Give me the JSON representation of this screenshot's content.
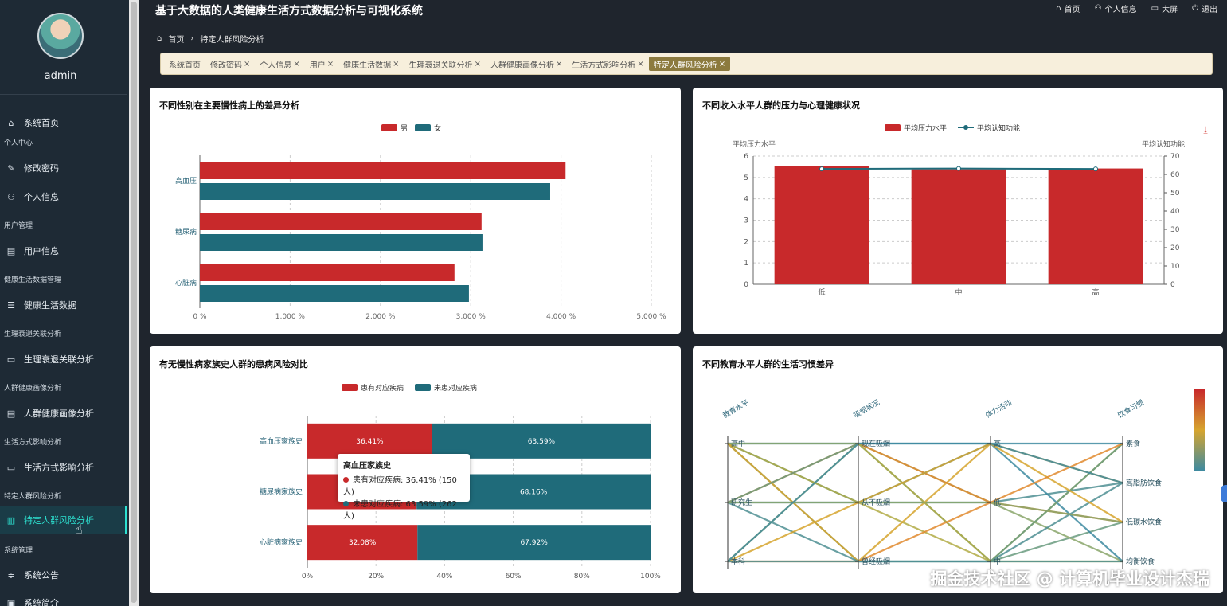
{
  "app": {
    "title": "基于大数据的人类健康生活方式数据分析与可视化系统"
  },
  "top_nav": [
    {
      "label": "首页",
      "icon": "home-icon"
    },
    {
      "label": "个人信息",
      "icon": "user-icon"
    },
    {
      "label": "大屏",
      "icon": "monitor-icon"
    },
    {
      "label": "退出",
      "icon": "power-icon"
    }
  ],
  "user": {
    "name": "admin"
  },
  "sidebar": {
    "groups": [
      {
        "label": "个人中心"
      },
      {
        "label": "用户管理"
      },
      {
        "label": "健康生活数据管理"
      },
      {
        "label": "生理衰退关联分析"
      },
      {
        "label": "人群健康画像分析"
      },
      {
        "label": "生活方式影响分析"
      },
      {
        "label": "特定人群风险分析"
      },
      {
        "label": "系统管理"
      }
    ],
    "items": [
      {
        "label": "系统首页",
        "icon": "home-icon"
      },
      {
        "label": "修改密码",
        "icon": "edit-icon"
      },
      {
        "label": "个人信息",
        "icon": "user-icon"
      },
      {
        "label": "用户信息",
        "icon": "clipboard-icon"
      },
      {
        "label": "健康生活数据",
        "icon": "list-icon"
      },
      {
        "label": "生理衰退关联分析",
        "icon": "monitor-icon"
      },
      {
        "label": "人群健康画像分析",
        "icon": "clipboard-icon"
      },
      {
        "label": "生活方式影响分析",
        "icon": "monitor-icon"
      },
      {
        "label": "特定人群风险分析",
        "icon": "chart-icon"
      },
      {
        "label": "系统公告",
        "icon": "sliders-icon"
      },
      {
        "label": "系统简介",
        "icon": "info-icon"
      }
    ]
  },
  "breadcrumb": {
    "home": "首页",
    "current": "特定人群风险分析"
  },
  "tags": [
    {
      "label": "系统首页",
      "closable": false
    },
    {
      "label": "修改密码",
      "closable": true
    },
    {
      "label": "个人信息",
      "closable": true
    },
    {
      "label": "用户",
      "closable": true
    },
    {
      "label": "健康生活数据",
      "closable": true
    },
    {
      "label": "生理衰退关联分析",
      "closable": true
    },
    {
      "label": "人群健康画像分析",
      "closable": true
    },
    {
      "label": "生活方式影响分析",
      "closable": true
    },
    {
      "label": "特定人群风险分析",
      "closable": true,
      "active": true
    }
  ],
  "colors": {
    "red": "#c8292b",
    "teal": "#1f6b7a"
  },
  "chart_data": [
    {
      "type": "bar",
      "orientation": "horizontal",
      "title": "不同性别在主要慢性病上的差异分析",
      "categories": [
        "高血压",
        "糖尿病",
        "心脏病"
      ],
      "series": [
        {
          "name": "男",
          "values": [
            4050,
            3120,
            2820
          ]
        },
        {
          "name": "女",
          "values": [
            3880,
            3130,
            2980
          ]
        }
      ],
      "x_ticks": [
        "0 %",
        "1,000 %",
        "2,000 %",
        "3,000 %",
        "4,000 %",
        "5,000 %"
      ],
      "xlim": [
        0,
        5000
      ],
      "legend": "top-center"
    },
    {
      "type": "bar",
      "title": "不同收入水平人群的压力与心理健康状况",
      "categories": [
        "低",
        "中",
        "高"
      ],
      "series": [
        {
          "name": "平均压力水平",
          "type": "bar",
          "values": [
            5.55,
            5.38,
            5.42
          ]
        },
        {
          "name": "平均认知功能",
          "type": "line",
          "values": [
            63,
            63.2,
            63
          ]
        }
      ],
      "ylabel": "平均压力水平",
      "y2label": "平均认知功能",
      "ylim": [
        0,
        6
      ],
      "y2lim": [
        0,
        70
      ],
      "y_ticks": [
        "0",
        "1",
        "2",
        "3",
        "4",
        "5",
        "6"
      ],
      "y2_ticks": [
        "0",
        "10",
        "20",
        "30",
        "40",
        "50",
        "60",
        "70"
      ],
      "legend": "top-center"
    },
    {
      "type": "bar",
      "stacked": "percent",
      "orientation": "horizontal",
      "title": "有无慢性病家族史人群的患病风险对比",
      "categories": [
        "高血压家族史",
        "糖尿病家族史",
        "心脏病家族史"
      ],
      "series": [
        {
          "name": "患有对应疾病",
          "values": [
            36.41,
            31.84,
            32.08
          ],
          "labels": [
            "36.41%",
            "",
            "32.08%"
          ]
        },
        {
          "name": "未患对应疾病",
          "values": [
            63.59,
            68.16,
            67.92
          ],
          "labels": [
            "63.59%",
            "68.16%",
            "67.92%"
          ]
        }
      ],
      "x_ticks": [
        "0%",
        "20%",
        "40%",
        "60%",
        "80%",
        "100%"
      ],
      "legend": "top-center",
      "tooltip": {
        "title": "高血压家族史",
        "lines": [
          "患有对应疾病: 36.41% (150人)",
          "未患对应疾病: 63.59% (262人)"
        ]
      }
    },
    {
      "type": "parallel",
      "title": "不同教育水平人群的生活习惯差异",
      "axes": [
        {
          "name": "教育水平",
          "categories": [
            "高中",
            "研究生",
            "本科"
          ]
        },
        {
          "name": "吸烟状况",
          "categories": [
            "现在吸烟",
            "从不吸烟",
            "曾经吸烟"
          ]
        },
        {
          "name": "体力活动",
          "categories": [
            "高",
            "低",
            "中"
          ]
        },
        {
          "name": "饮食习惯",
          "categories": [
            "素食",
            "高脂肪饮食",
            "低碳水饮食",
            "均衡饮食"
          ]
        }
      ],
      "lines": [
        [
          0,
          0,
          0,
          0
        ],
        [
          0,
          1,
          1,
          1
        ],
        [
          0,
          2,
          2,
          2
        ],
        [
          0,
          0,
          1,
          3
        ],
        [
          0,
          1,
          2,
          0
        ],
        [
          0,
          2,
          0,
          1
        ],
        [
          1,
          0,
          1,
          2
        ],
        [
          1,
          1,
          0,
          3
        ],
        [
          1,
          2,
          2,
          1
        ],
        [
          1,
          0,
          2,
          0
        ],
        [
          1,
          1,
          1,
          2
        ],
        [
          2,
          0,
          2,
          3
        ],
        [
          2,
          1,
          0,
          2
        ],
        [
          2,
          2,
          1,
          0
        ],
        [
          2,
          0,
          0,
          1
        ],
        [
          2,
          2,
          2,
          3
        ]
      ]
    }
  ],
  "watermark": "掘金技术社区 @ 计算机毕业设计杰瑞"
}
